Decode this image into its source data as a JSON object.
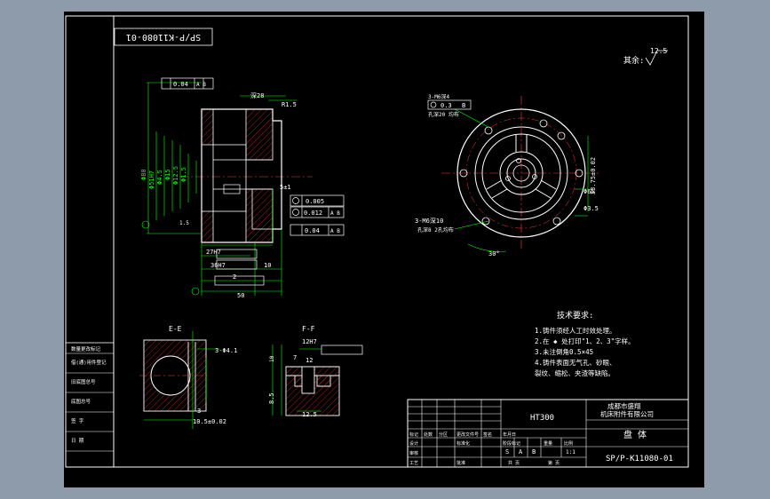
{
  "colors": {
    "background": "#000000",
    "outline": "#ffffff",
    "dimension": "#00ff00",
    "center_line": "#ff3b3b",
    "hatch": "#ff3b3b",
    "annotation": "#ffffff",
    "frame": "#8e9bab"
  },
  "drawing_number_rotated": "SP/P-K11080-01",
  "surface_finish": {
    "label": "其余:",
    "value": "12.5"
  },
  "main_view": {
    "tolerances": {
      "flatness": "0.04",
      "datum_ab": "A B",
      "fc1_value": "0.005",
      "fc2_value": "0.012",
      "fc3_value": "0.04",
      "fc4_value": "0.04"
    },
    "dims": {
      "d80": "Φ80",
      "d51": "Φ51H7",
      "d45": "Φ4.5",
      "d15": "Φ15",
      "d125": "Φ12.5",
      "d15b": "Φ1.5",
      "w27": "27H7",
      "w36": "36H7",
      "w10": "10",
      "w50": "50",
      "w2": "2",
      "c15": "1.5",
      "c5": "5±1",
      "c28": "深28",
      "r15": "R1.5"
    }
  },
  "side_view": {
    "holes_top": "3-M6深4",
    "holes_top_sub": "孔深20 均布",
    "tol": "0.3",
    "tol_datum": "B",
    "d33": "33.75±0.02",
    "d65": "Φ65",
    "d35": "Φ3.5",
    "holes_bot": "3-M6深10",
    "holes_bot_sub": "孔深8 2孔均布",
    "angle": "30°"
  },
  "section_e": {
    "title": "E-E",
    "d41": "3-Φ4.1",
    "d3": "3",
    "dim": "10.5±0.02"
  },
  "section_f": {
    "title": "F-F",
    "d12": "12H7",
    "d7": "7",
    "d12b": "12",
    "d85": "8.5",
    "d125": "12.5",
    "d10": "10"
  },
  "tech": {
    "title": "技术要求:",
    "items": [
      "1.铸件须经人工时效处理。",
      "2.在 ◆ 处打印\"1、2、3\"字样。",
      "3.未注倒角0.5×45",
      "4.铸件表面无气孔、砂眼、",
      "  裂纹、缩松、夹渣等缺陷。"
    ]
  },
  "change_table": {
    "rows": [
      "数量更改标记",
      "借(通)用件登记",
      "旧底图总号",
      "底图总号",
      "签 字",
      "日 期"
    ]
  },
  "title_block": {
    "material": "HT300",
    "company_l1": "成都市盛翔",
    "company_l2": "机床附件有限公司",
    "part_name": "盘 体",
    "drawing_number": "SP/P-K11080-01",
    "scale": "1:1",
    "stage_marks": [
      "S",
      "A",
      "B"
    ],
    "row_labels": [
      "标记",
      "处数",
      "分区",
      "更改文件号",
      "签名",
      "年月日"
    ],
    "row_labels2": [
      "设计",
      "",
      "标准化"
    ],
    "row_labels3": [
      "审核",
      "",
      "工艺",
      "",
      "批准"
    ],
    "col_labels": [
      "阶段标记",
      "重量",
      "比例"
    ],
    "sheet_info": [
      "共 页",
      "第 页"
    ]
  }
}
